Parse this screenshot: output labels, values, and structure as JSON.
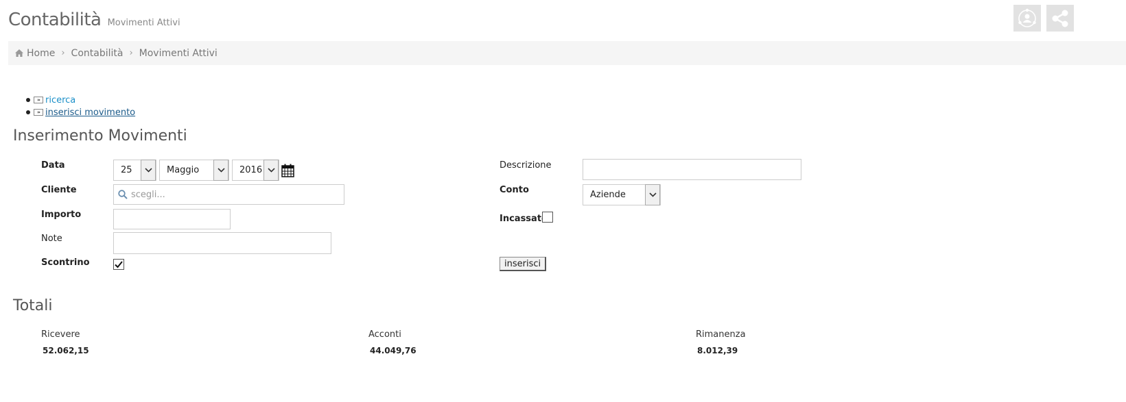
{
  "header": {
    "title": "Contabilità",
    "subtitle": "Movimenti Attivi"
  },
  "top_buttons": [
    {
      "icon": "user-circle-icon"
    },
    {
      "icon": "share-icon"
    }
  ],
  "breadcrumb": {
    "items": [
      "Home",
      "Contabilità",
      "Movimenti Attivi"
    ],
    "home_icon": "home-icon"
  },
  "links": [
    {
      "label": "ricerca",
      "icon": "double-arrow-icon"
    },
    {
      "label": "inserisci movimento",
      "icon": "double-arrow-icon"
    }
  ],
  "form": {
    "title": "Inserimento Movimenti",
    "labels": {
      "data": "Data",
      "cliente": "Cliente",
      "importo": "Importo",
      "note": "Note",
      "scontrino": "Scontrino",
      "descrizione": "Descrizione",
      "conto": "Conto",
      "incassato": "Incassato"
    },
    "date": {
      "day": "25",
      "month": "Maggio",
      "year": "2016"
    },
    "cliente_placeholder": "scegli...",
    "importo": "",
    "note": "",
    "descrizione": "",
    "conto": "Aziende",
    "scontrino_checked": true,
    "incassato_checked": false,
    "submit_label": "inserisci"
  },
  "totals": {
    "title": "Totali",
    "items": [
      {
        "label": "Ricevere",
        "value": "52.062,15"
      },
      {
        "label": "Acconti",
        "value": "44.049,76"
      },
      {
        "label": "Rimanenza",
        "value": "8.012,39"
      }
    ]
  },
  "colors": {
    "link": "#1a8fc8",
    "breadcrumb_bg": "#f5f5f5",
    "top_button_bg": "#e2e2e2"
  }
}
